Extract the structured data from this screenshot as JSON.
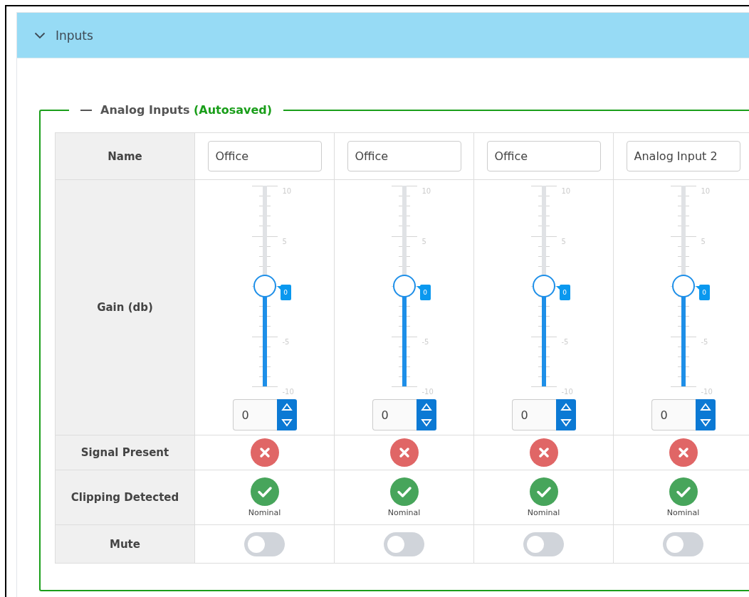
{
  "panel": {
    "title": "Inputs",
    "expanded": true
  },
  "group": {
    "title": "Analog Inputs",
    "status": "(Autosaved)",
    "expanded": true
  },
  "row_labels": [
    "Name",
    "Gain (db)",
    "Signal Present",
    "Clipping Detected",
    "Mute"
  ],
  "channels": [
    {
      "name": "Office",
      "gain": {
        "level": 0.5,
        "scale": [
          "10",
          "5",
          "-5",
          "-10"
        ],
        "bubble": "0",
        "value": "0"
      },
      "signal_present": false,
      "clipping": {
        "detected": false,
        "status": "Nominal"
      },
      "mute": {
        "on": false
      }
    },
    {
      "name": "Office",
      "gain": {
        "level": 0.5,
        "scale": [
          "10",
          "5",
          "-5",
          "-10"
        ],
        "bubble": "0",
        "value": "0"
      },
      "signal_present": false,
      "clipping": {
        "detected": false,
        "status": "Nominal"
      },
      "mute": {
        "on": false
      }
    },
    {
      "name": "Office",
      "gain": {
        "level": 0.5,
        "scale": [
          "10",
          "5",
          "-5",
          "-10"
        ],
        "bubble": "0",
        "value": "0"
      },
      "signal_present": false,
      "clipping": {
        "detected": false,
        "status": "Nominal"
      },
      "mute": {
        "on": false
      }
    },
    {
      "name": "Analog Input 2",
      "gain": {
        "level": 0.5,
        "scale": [
          "10",
          "5",
          "-5",
          "-10"
        ],
        "bubble": "0",
        "value": "0"
      },
      "signal_present": false,
      "clipping": {
        "detected": false,
        "status": "Nominal"
      },
      "mute": {
        "on": false
      }
    }
  ]
}
